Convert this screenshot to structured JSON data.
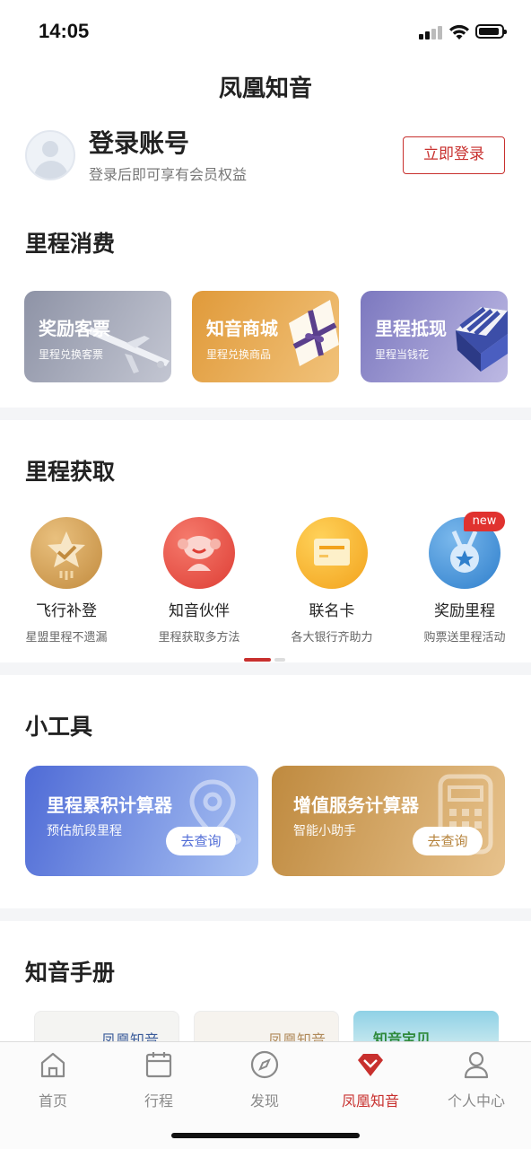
{
  "status_bar": {
    "time": "14:05"
  },
  "header": {
    "title": "凤凰知音"
  },
  "login": {
    "title": "登录账号",
    "subtitle": "登录后即可享有会员权益",
    "button": "立即登录"
  },
  "consume": {
    "title": "里程消费",
    "cards": [
      {
        "title": "奖励客票",
        "subtitle": "里程兑换客票",
        "icon": "airplane-icon",
        "color": "#a3a7b8"
      },
      {
        "title": "知音商城",
        "subtitle": "里程兑换商品",
        "icon": "gift-box-icon",
        "color": "#e4a84f"
      },
      {
        "title": "里程抵现",
        "subtitle": "里程当钱花",
        "icon": "shop-icon",
        "color": "#8b87c4"
      }
    ]
  },
  "acquire": {
    "title": "里程获取",
    "items": [
      {
        "name": "飞行补登",
        "desc": "星盟里程不遗漏",
        "icon": "star-check-icon"
      },
      {
        "name": "知音伙伴",
        "desc": "里程获取多方法",
        "icon": "partner-icon"
      },
      {
        "name": "联名卡",
        "desc": "各大银行齐助力",
        "icon": "card-icon"
      },
      {
        "name": "奖励里程",
        "desc": "购票送里程活动",
        "icon": "medal-icon"
      }
    ],
    "new_badge": "new"
  },
  "tools": {
    "title": "小工具",
    "cards": [
      {
        "title": "里程累积计算器",
        "subtitle": "预估航段里程",
        "button": "去查询",
        "icon": "location-pin-icon",
        "color": "#5b78d8"
      },
      {
        "title": "增值服务计算器",
        "subtitle": "智能小助手",
        "button": "去查询",
        "icon": "calculator-icon",
        "color": "#c9974f"
      }
    ]
  },
  "handbook": {
    "title": "知音手册",
    "items": [
      {
        "label": "凤凰知音"
      },
      {
        "label": "凤凰知音"
      },
      {
        "label": "知音宝贝"
      }
    ]
  },
  "tabbar": {
    "items": [
      {
        "label": "首页",
        "icon": "home-icon",
        "active": false
      },
      {
        "label": "行程",
        "icon": "calendar-icon",
        "active": false
      },
      {
        "label": "发现",
        "icon": "compass-icon",
        "active": false
      },
      {
        "label": "凤凰知音",
        "icon": "phoenix-gem-icon",
        "active": true
      },
      {
        "label": "个人中心",
        "icon": "person-icon",
        "active": false
      }
    ]
  }
}
